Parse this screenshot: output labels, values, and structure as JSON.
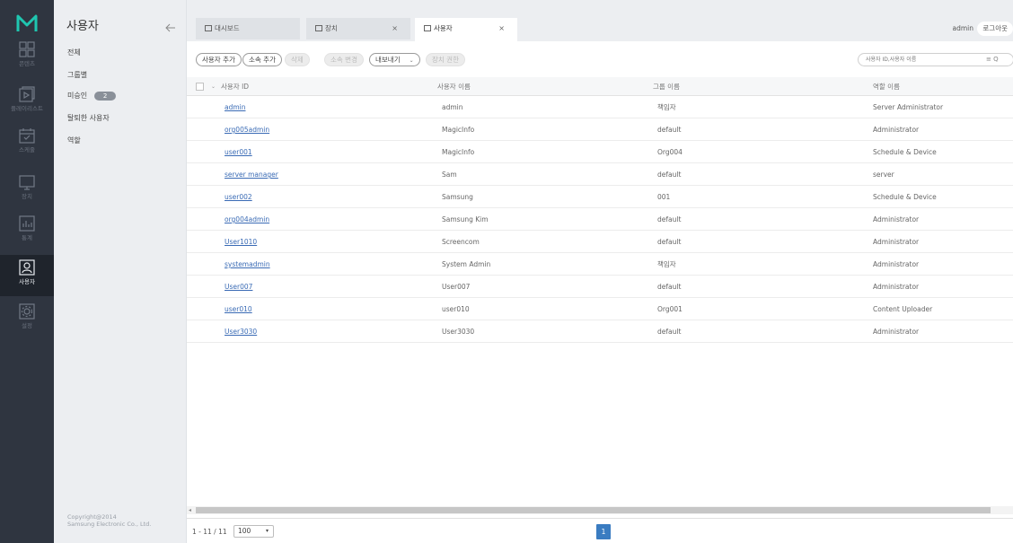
{
  "rail": {
    "items": [
      {
        "label": "콘텐츠",
        "icon": "contents-grid-icon"
      },
      {
        "label": "플레이리스트",
        "icon": "playlist-icon"
      },
      {
        "label": "스케줄",
        "icon": "schedule-calendar-icon"
      },
      {
        "label": "장치",
        "icon": "device-monitor-icon"
      },
      {
        "label": "통계",
        "icon": "statistics-chart-icon"
      },
      {
        "label": "사용자",
        "icon": "user-icon"
      },
      {
        "label": "설정",
        "icon": "settings-gear-icon"
      }
    ]
  },
  "sidebar": {
    "title": "사용자",
    "items": [
      {
        "label": "전체"
      },
      {
        "label": "그룹별"
      },
      {
        "label": "미승인",
        "badge": "2"
      },
      {
        "label": "탈퇴한 사용자"
      },
      {
        "label": "역할"
      }
    ],
    "copyright_line1": "Copyright@2014",
    "copyright_line2": "Samsung Electronic Co., Ltd."
  },
  "tabs": [
    {
      "label": "대시보드",
      "icon": "dashboard-icon"
    },
    {
      "label": "장치",
      "icon": "device-icon",
      "close": "×"
    },
    {
      "label": "사용자",
      "icon": "user-tab-icon",
      "close": "×"
    }
  ],
  "header": {
    "user": "admin",
    "logout": "로그아웃"
  },
  "toolbar": {
    "add_user": "사용자 추가",
    "add_org": "소속 추가",
    "delete": "삭제",
    "change_org": "소속 변경",
    "export": "내보내기",
    "device_permission": "장치 권한",
    "search_placeholder": "사용자 ID,사용자 이름",
    "search_icons": "≡  Q"
  },
  "table": {
    "headers": {
      "id": "사용자 ID",
      "name": "사용자 이름",
      "group": "그룹 이름",
      "role": "역할 이름"
    },
    "rows": [
      {
        "id": "admin",
        "name": "admin",
        "group": "책임자",
        "role": "Server Administrator"
      },
      {
        "id": "org005admin",
        "name": "MagicInfo",
        "group": "default",
        "role": "Administrator"
      },
      {
        "id": "user001",
        "name": "MagicInfo",
        "group": "Org004",
        "role": "Schedule & Device"
      },
      {
        "id": "server manager",
        "name": "Sam",
        "group": "default",
        "role": "server"
      },
      {
        "id": "user002",
        "name": "Samsung",
        "group": "001",
        "role": "Schedule & Device"
      },
      {
        "id": "org004admin",
        "name": "Samsung Kim",
        "group": "default",
        "role": "Administrator"
      },
      {
        "id": "User1010",
        "name": "Screencom",
        "group": "default",
        "role": "Administrator"
      },
      {
        "id": "systemadmin",
        "name": "System Admin",
        "group": "책임자",
        "role": "Administrator"
      },
      {
        "id": "User007",
        "name": "User007",
        "group": "default",
        "role": "Administrator"
      },
      {
        "id": "user010",
        "name": "user010",
        "group": "Org001",
        "role": "Content Uploader"
      },
      {
        "id": "User3030",
        "name": "User3030",
        "group": "default",
        "role": "Administrator"
      }
    ]
  },
  "footer": {
    "range": "1 - 11 / 11",
    "page_size": "100",
    "current_page": "1"
  }
}
